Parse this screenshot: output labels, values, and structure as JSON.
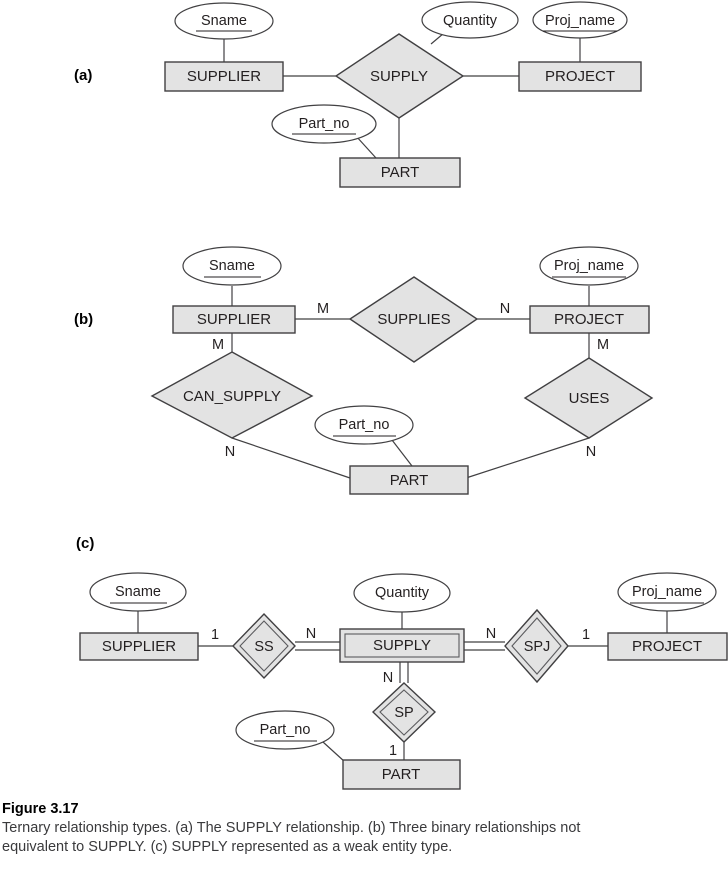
{
  "figure": {
    "number": "Figure 3.17",
    "caption": "Ternary relationship types. (a) The SUPPLY relationship. (b) Three binary relationships not equivalent to SUPPLY. (c) SUPPLY represented as a weak entity type."
  },
  "colors": {
    "shape_fill": "#e3e3e3",
    "shape_stroke": "#414042",
    "ellipse_fill": "#ffffff",
    "text": "#231f20",
    "page_background": "#ffffff"
  },
  "parts": {
    "a": {
      "label": "(a)",
      "entities": [
        {
          "name": "SUPPLIER",
          "label": "SUPPLIER"
        },
        {
          "name": "PROJECT",
          "label": "PROJECT"
        },
        {
          "name": "PART",
          "label": "PART"
        }
      ],
      "relationships": [
        {
          "name": "SUPPLY",
          "label": "SUPPLY",
          "kind": "diamond"
        }
      ],
      "attributes": [
        {
          "name": "Sname",
          "label": "Sname",
          "key": true
        },
        {
          "name": "Quantity",
          "label": "Quantity",
          "key": false
        },
        {
          "name": "Proj_name",
          "label": "Proj_name",
          "key": true
        },
        {
          "name": "Part_no",
          "label": "Part_no",
          "key": true
        }
      ],
      "cardinalities": []
    },
    "b": {
      "label": "(b)",
      "entities": [
        {
          "name": "SUPPLIER",
          "label": "SUPPLIER"
        },
        {
          "name": "PROJECT",
          "label": "PROJECT"
        },
        {
          "name": "PART",
          "label": "PART"
        }
      ],
      "relationships": [
        {
          "name": "SUPPLIES",
          "label": "SUPPLIES",
          "kind": "diamond"
        },
        {
          "name": "CAN_SUPPLY",
          "label": "CAN_SUPPLY",
          "kind": "diamond"
        },
        {
          "name": "USES",
          "label": "USES",
          "kind": "diamond"
        }
      ],
      "attributes": [
        {
          "name": "Sname",
          "label": "Sname",
          "key": true
        },
        {
          "name": "Proj_name",
          "label": "Proj_name",
          "key": true
        },
        {
          "name": "Part_no",
          "label": "Part_no",
          "key": true
        }
      ],
      "cardinalities": [
        {
          "name": "supplier-supplies",
          "label": "M"
        },
        {
          "name": "supplies-project",
          "label": "N"
        },
        {
          "name": "supplier-can-supply",
          "label": "M"
        },
        {
          "name": "can-supply-part",
          "label": "N"
        },
        {
          "name": "project-uses",
          "label": "M"
        },
        {
          "name": "uses-part",
          "label": "N"
        }
      ]
    },
    "c": {
      "label": "(c)",
      "entities": [
        {
          "name": "SUPPLIER",
          "label": "SUPPLIER"
        },
        {
          "name": "SUPPLY",
          "label": "SUPPLY",
          "weak": true
        },
        {
          "name": "PROJECT",
          "label": "PROJECT"
        },
        {
          "name": "PART",
          "label": "PART"
        }
      ],
      "relationships": [
        {
          "name": "SS",
          "label": "SS",
          "kind": "double-diamond"
        },
        {
          "name": "SPJ",
          "label": "SPJ",
          "kind": "double-diamond"
        },
        {
          "name": "SP",
          "label": "SP",
          "kind": "double-diamond"
        }
      ],
      "attributes": [
        {
          "name": "Sname",
          "label": "Sname",
          "key": true
        },
        {
          "name": "Quantity",
          "label": "Quantity",
          "key": false
        },
        {
          "name": "Proj_name",
          "label": "Proj_name",
          "key": true
        },
        {
          "name": "Part_no",
          "label": "Part_no",
          "key": true
        }
      ],
      "cardinalities": [
        {
          "name": "supplier-ss",
          "label": "1"
        },
        {
          "name": "ss-supply",
          "label": "N"
        },
        {
          "name": "supply-spj",
          "label": "N"
        },
        {
          "name": "spj-project",
          "label": "1"
        },
        {
          "name": "supply-sp",
          "label": "N"
        },
        {
          "name": "sp-part",
          "label": "1"
        }
      ]
    }
  }
}
